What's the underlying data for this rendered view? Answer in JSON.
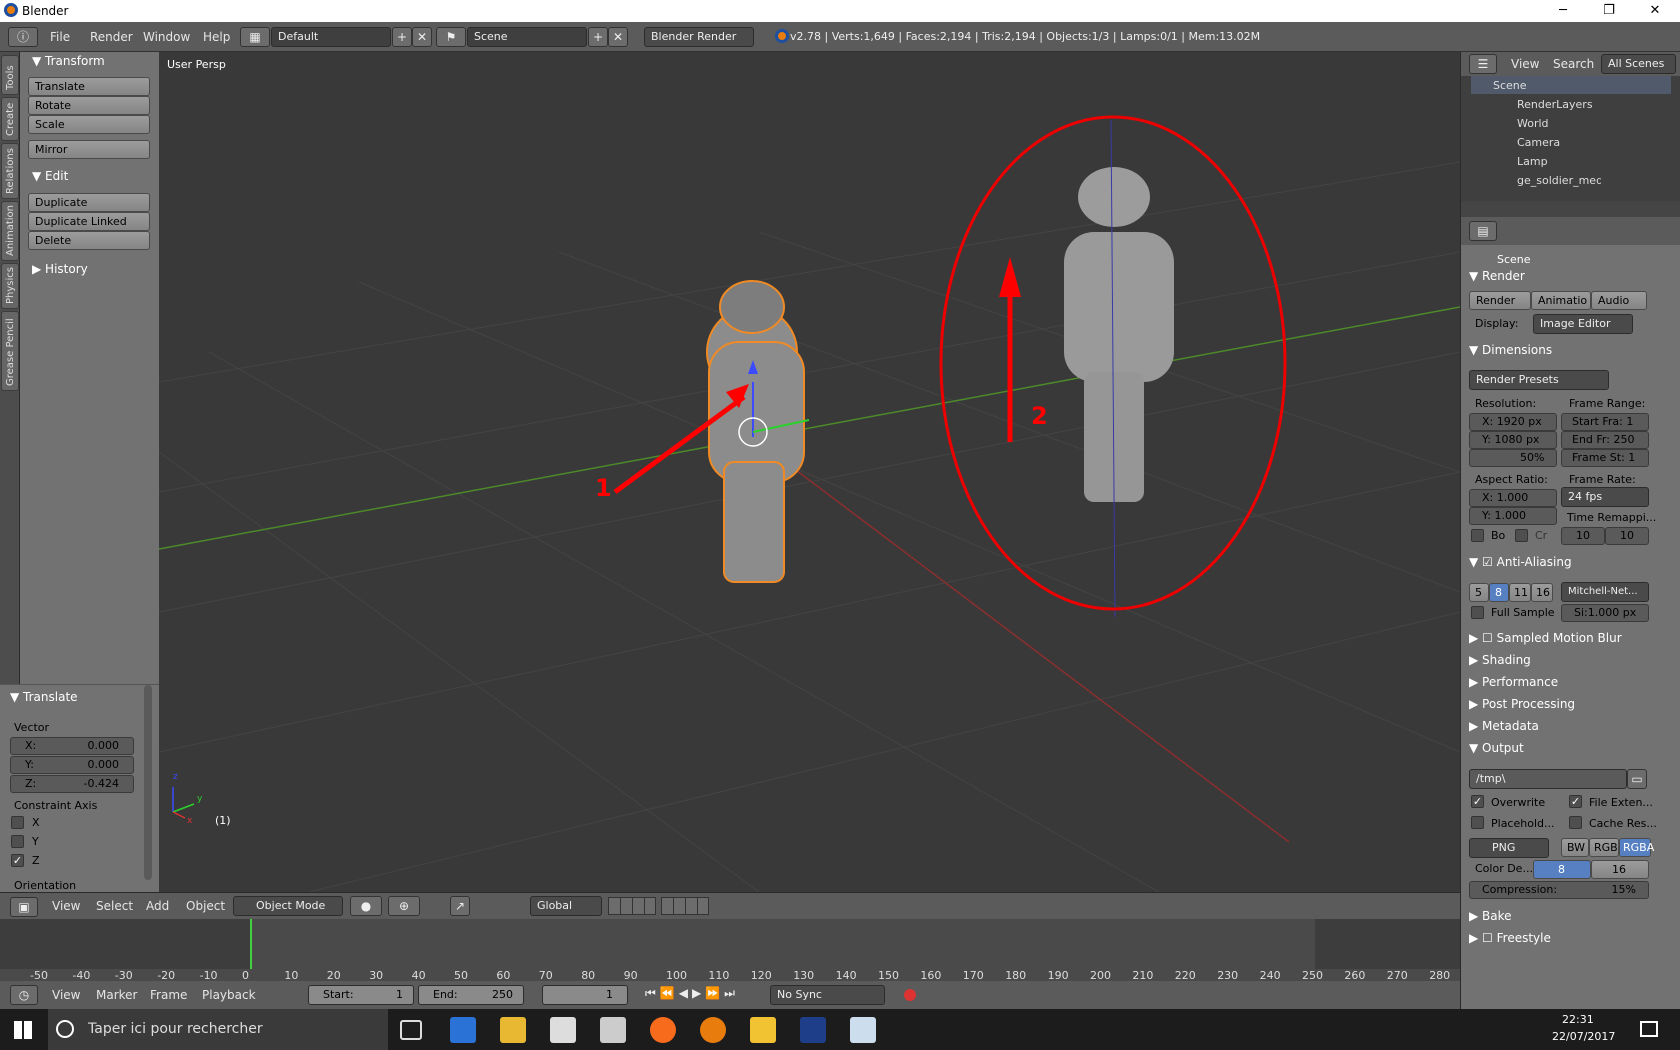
{
  "window": {
    "title": "Blender",
    "min": "─",
    "max": "❐",
    "close": "✕"
  },
  "infobar": {
    "menus": [
      "File",
      "Render",
      "Window",
      "Help"
    ],
    "layout": "Default",
    "scene": "Scene",
    "engine": "Blender Render",
    "stats": "v2.78 | Verts:1,649 | Faces:2,194 | Tris:2,194 | Objects:1/3 | Lamps:0/1 | Mem:13.02M"
  },
  "left_tabs": [
    "Tools",
    "Create",
    "Relations",
    "Animation",
    "Physics",
    "Grease Pencil"
  ],
  "tool_panel": {
    "transform_header": "Transform",
    "transform_buttons": [
      "Translate",
      "Rotate",
      "Scale"
    ],
    "mirror": "Mirror",
    "edit_header": "Edit",
    "edit_buttons": [
      "Duplicate",
      "Duplicate Linked",
      "Delete"
    ],
    "history_header": "History"
  },
  "operator_panel": {
    "header": "Translate",
    "vector_label": "Vector",
    "x_label": "X:",
    "x_value": "0.000",
    "y_label": "Y:",
    "y_value": "0.000",
    "z_label": "Z:",
    "z_value": "-0.424",
    "constraint_label": "Constraint Axis",
    "axes": [
      "X",
      "Y",
      "Z"
    ],
    "orientation_label": "Orientation"
  },
  "viewport": {
    "label": "User Persp",
    "frame_label": "(1)",
    "annotation_1": "1",
    "annotation_2": "2",
    "axis_x": "x",
    "axis_y": "y",
    "axis_z": "z",
    "colors": {
      "annotation": "#ff0000",
      "selection": "#f08a24",
      "grid_x": "#8b2e2e",
      "grid_y": "#4d8a2a"
    }
  },
  "viewport_header": {
    "menus": [
      "View",
      "Select",
      "Add",
      "Object"
    ],
    "mode": "Object Mode",
    "orientation": "Global"
  },
  "timeline": {
    "ticks": [
      "-50",
      "-40",
      "-30",
      "-20",
      "-10",
      "0",
      "10",
      "20",
      "30",
      "40",
      "50",
      "60",
      "70",
      "80",
      "90",
      "100",
      "110",
      "120",
      "130",
      "140",
      "150",
      "160",
      "170",
      "180",
      "190",
      "200",
      "210",
      "220",
      "230",
      "240",
      "250",
      "260",
      "270",
      "280"
    ],
    "menus": [
      "View",
      "Marker",
      "Frame",
      "Playback"
    ],
    "start_label": "Start:",
    "start_value": "1",
    "end_label": "End:",
    "end_value": "250",
    "current": "1",
    "sync": "No Sync"
  },
  "outliner": {
    "menus": [
      "View",
      "Search",
      "All Scenes"
    ],
    "items": [
      "Scene",
      "RenderLayers",
      "World",
      "Camera",
      "Lamp",
      "ge_soldier_medic"
    ]
  },
  "properties": {
    "scene_label": "Scene",
    "render_header": "Render",
    "render_buttons": [
      "Render",
      "Animatio",
      "Audio"
    ],
    "display_label": "Display:",
    "display_value": "Image Editor",
    "dimensions_header": "Dimensions",
    "presets": "Render Presets",
    "resolution_label": "Resolution:",
    "res_x": "X: 1920 px",
    "res_y": "Y: 1080 px",
    "res_pct": "50%",
    "frame_range_label": "Frame Range:",
    "start_fra": "Start Fra: 1",
    "end_fr": "End Fr: 250",
    "frame_st": "Frame St: 1",
    "aspect_label": "Aspect Ratio:",
    "aspect_x": "X: 1.000",
    "aspect_y": "Y: 1.000",
    "frame_rate_label": "Frame Rate:",
    "fps": "24 fps",
    "time_remap_label": "Time Remappi...",
    "remap_old": "10",
    "remap_new": "10",
    "bo_label": "Bo",
    "cr_label": "Cr",
    "aa_header": "Anti-Aliasing",
    "aa_samples": [
      "5",
      "8",
      "11",
      "16"
    ],
    "aa_filter": "Mitchell-Net...",
    "full_sample": "Full Sample",
    "si_value": "Si:1.000 px",
    "collapsed": [
      "Sampled Motion Blur",
      "Shading",
      "Performance",
      "Post Processing",
      "Metadata"
    ],
    "output_header": "Output",
    "output_path": "/tmp\\",
    "overwrite": "Overwrite",
    "file_ext": "File Exten...",
    "placeholders": "Placehold...",
    "cache_res": "Cache Res...",
    "format": "PNG",
    "color_modes": [
      "BW",
      "RGB",
      "RGBA"
    ],
    "color_depth_label": "Color De...",
    "depth_8": "8",
    "depth_16": "16",
    "compression": "Compression:",
    "compression_value": "15%",
    "bake_header": "Bake",
    "freestyle_header": "Freestyle"
  },
  "taskbar": {
    "search_placeholder": "Taper ici pour rechercher",
    "time": "22:31",
    "date": "22/07/2017"
  }
}
